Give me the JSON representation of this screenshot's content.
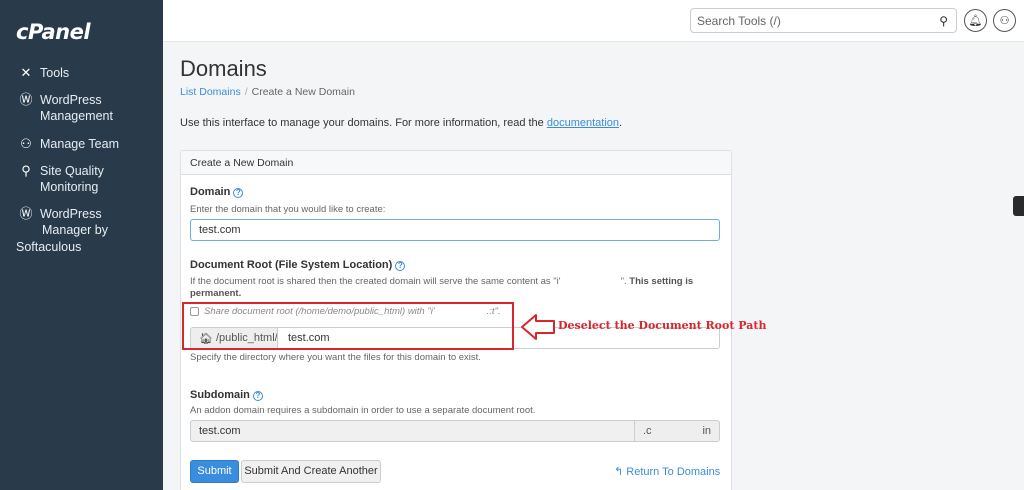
{
  "app": {
    "logo": "cPanel"
  },
  "sidebar": {
    "items": [
      {
        "icon": "tools-icon",
        "label_lines": [
          "Tools"
        ]
      },
      {
        "icon": "wordpress-icon",
        "label_lines": [
          "WordPress",
          "Management"
        ]
      },
      {
        "icon": "manage-team-icon",
        "label_lines": [
          "Manage Team"
        ]
      },
      {
        "icon": "site-quality-icon",
        "label_lines": [
          "Site Quality",
          "Monitoring"
        ]
      },
      {
        "icon": "wordpress-icon",
        "label_lines": [
          "WordPress",
          "Manager by",
          "Softaculous"
        ]
      }
    ]
  },
  "topbar": {
    "search_placeholder": "Search Tools (/)"
  },
  "page": {
    "title": "Domains",
    "breadcrumb": {
      "link": "List Domains",
      "separator": "/",
      "current": "Create a New Domain"
    },
    "intro_text": "Use this interface to manage your domains. For more information, read the ",
    "intro_link": "documentation",
    "intro_end": "."
  },
  "form": {
    "panel_title": "Create a New Domain",
    "domain": {
      "label": "Domain",
      "help": "Enter the domain that you would like to create:",
      "value": "test.com"
    },
    "docroot": {
      "label": "Document Root (File System Location)",
      "help_line1_a": "If the document root is shared then the created domain will serve the same content as \"i'",
      "help_line1_b": "\". ",
      "help_line1_bold": "This setting is",
      "help_line2_bold": "permanent.",
      "checkbox_label_a": "Share document root (/home/demo/public_html) with \"i'",
      "checkbox_label_b": ".:t\".",
      "checked": false,
      "prefix": "/public_html/",
      "value": "test.com",
      "specify_help": "Specify the directory where you want the files for this domain to exist."
    },
    "subdomain": {
      "label": "Subdomain",
      "help": "An addon domain requires a subdomain in order to use a separate document root.",
      "value": "test.com",
      "suffix_a": ".c",
      "suffix_b": "in"
    },
    "buttons": {
      "submit": "Submit",
      "submit_another": "Submit And Create Another",
      "return": "Return To Domains"
    }
  },
  "annotation": {
    "text": "Deselect the Document Root Path",
    "color": "#d9262d"
  },
  "colors": {
    "sidebar_bg": "#293a4a",
    "accent": "#3a8dde",
    "annotation": "#d9262d"
  }
}
